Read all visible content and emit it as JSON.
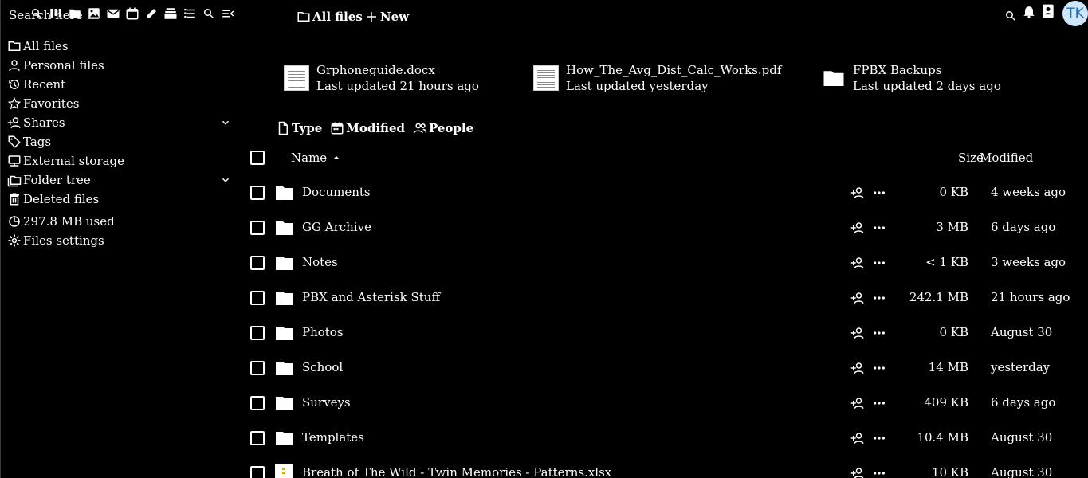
{
  "header": {
    "search_placeholder": "Search here ...",
    "app_icons": [
      "dashboard-icon",
      "files-icon",
      "photos-icon",
      "mail-icon",
      "calendar-icon",
      "notes-icon",
      "deck-icon",
      "tasks-icon",
      "unified-search-icon",
      "menu-collapse-icon"
    ],
    "breadcrumb_label": "All files",
    "new_label": "New",
    "avatar_initials": "TK"
  },
  "sidebar": {
    "items": [
      {
        "label": "All files",
        "icon": "folder-icon"
      },
      {
        "label": "Personal files",
        "icon": "account-icon"
      },
      {
        "label": "Recent",
        "icon": "history-icon"
      },
      {
        "label": "Favorites",
        "icon": "star-icon"
      },
      {
        "label": "Shares",
        "icon": "share-icon",
        "expandable": true
      },
      {
        "label": "Tags",
        "icon": "tag-icon"
      },
      {
        "label": "External storage",
        "icon": "external-storage-icon"
      },
      {
        "label": "Folder tree",
        "icon": "folder-tree-icon",
        "expandable": true
      },
      {
        "label": "Deleted files",
        "icon": "trash-icon"
      }
    ],
    "quota": "297.8 MB used",
    "settings": "Files settings"
  },
  "recommended": [
    {
      "name": "Grphoneguide.docx",
      "updated": "Last updated 21 hours ago",
      "kind": "document"
    },
    {
      "name": "How_The_Avg_Dist_Calc_Works.pdf",
      "updated": "Last updated yesterday",
      "kind": "document"
    },
    {
      "name": "FPBX Backups",
      "updated": "Last updated 2 days ago",
      "kind": "folder"
    }
  ],
  "filters": {
    "type": "Type",
    "modified": "Modified",
    "people": "People"
  },
  "table": {
    "col_name": "Name",
    "col_size": "Size",
    "col_modified": "Modified",
    "rows": [
      {
        "name": "Documents",
        "size": "0 KB",
        "modified": "4 weeks ago",
        "kind": "folder"
      },
      {
        "name": "GG Archive",
        "size": "3 MB",
        "modified": "6 days ago",
        "kind": "folder"
      },
      {
        "name": "Notes",
        "size": "< 1 KB",
        "modified": "3 weeks ago",
        "kind": "folder"
      },
      {
        "name": "PBX and Asterisk Stuff",
        "size": "242.1 MB",
        "modified": "21 hours ago",
        "kind": "folder"
      },
      {
        "name": "Photos",
        "size": "0 KB",
        "modified": "August 30",
        "kind": "folder"
      },
      {
        "name": "School",
        "size": "14 MB",
        "modified": "yesterday",
        "kind": "folder"
      },
      {
        "name": "Surveys",
        "size": "409 KB",
        "modified": "6 days ago",
        "kind": "folder"
      },
      {
        "name": "Templates",
        "size": "10.4 MB",
        "modified": "August 30",
        "kind": "folder"
      },
      {
        "name": "Breath of The Wild - Twin Memories - Patterns.xlsx",
        "size": "10 KB",
        "modified": "August 30",
        "kind": "spreadsheet"
      }
    ]
  }
}
